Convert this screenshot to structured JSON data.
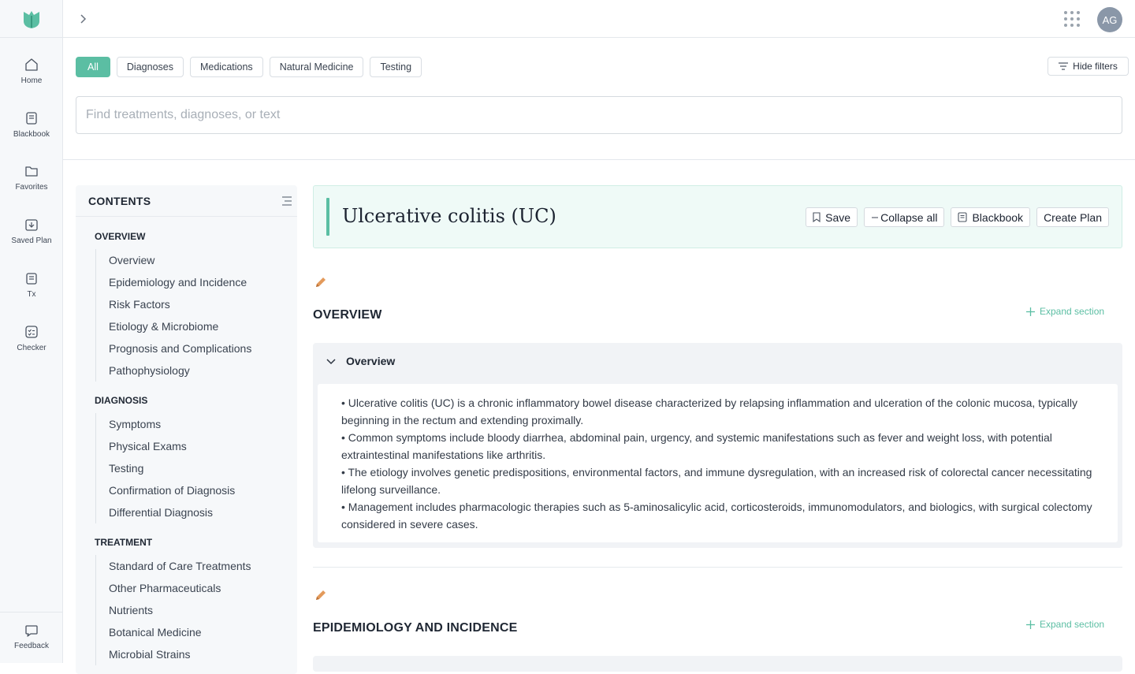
{
  "rail": {
    "items": [
      {
        "label": "Home",
        "icon": "home-icon"
      },
      {
        "label": "Blackbook",
        "icon": "book-icon"
      },
      {
        "label": "Favorites",
        "icon": "folder-icon"
      },
      {
        "label": "Saved Plan",
        "icon": "saved-plan-icon"
      },
      {
        "label": "Tx",
        "icon": "clipboard-icon"
      },
      {
        "label": "Checker",
        "icon": "checker-icon"
      }
    ],
    "feedback": "Feedback",
    "brand_color": "#5bbea3"
  },
  "topbar": {
    "avatar": "AG"
  },
  "filters": {
    "chips": [
      "All",
      "Diagnoses",
      "Medications",
      "Natural Medicine",
      "Testing"
    ],
    "active": "All",
    "hide_label": "Hide filters"
  },
  "search": {
    "placeholder": "Find treatments, diagnoses, or text",
    "value": ""
  },
  "toc": {
    "title": "CONTENTS",
    "sections": [
      {
        "title": "OVERVIEW",
        "items": [
          "Overview",
          "Epidemiology and Incidence",
          "Risk Factors",
          "Etiology & Microbiome",
          "Prognosis and Complications",
          "Pathophysiology"
        ]
      },
      {
        "title": "DIAGNOSIS",
        "items": [
          "Symptoms",
          "Physical Exams",
          "Testing",
          "Confirmation of Diagnosis",
          "Differential Diagnosis"
        ]
      },
      {
        "title": "TREATMENT",
        "items": [
          "Standard of Care Treatments",
          "Other Pharmaceuticals",
          "Nutrients",
          "Botanical Medicine",
          "Microbial Strains"
        ]
      }
    ]
  },
  "article": {
    "title": "Ulcerative colitis (UC)",
    "actions": {
      "save": "Save",
      "collapse": "Collapse all",
      "blackbook": "Blackbook",
      "plan": "Create Plan"
    },
    "expand_label": "Expand section",
    "sections": [
      {
        "title": "OVERVIEW",
        "panel_title": "Overview",
        "bullets": [
          "• Ulcerative colitis (UC) is a chronic inflammatory bowel disease characterized by relapsing inflammation and ulceration of the colonic mucosa, typically beginning in the rectum and extending proximally.",
          "• Common symptoms include bloody diarrhea, abdominal pain, urgency, and systemic manifestations such as fever and weight loss, with potential extraintestinal manifestations like arthritis.",
          "• The etiology involves genetic predispositions, environmental factors, and immune dysregulation, with an increased risk of colorectal cancer necessitating lifelong surveillance.",
          "• Management includes pharmacologic therapies such as 5-aminosalicylic acid, corticosteroids, immunomodulators, and biologics, with surgical colectomy considered in severe cases."
        ]
      },
      {
        "title": "EPIDEMIOLOGY AND INCIDENCE"
      }
    ]
  }
}
